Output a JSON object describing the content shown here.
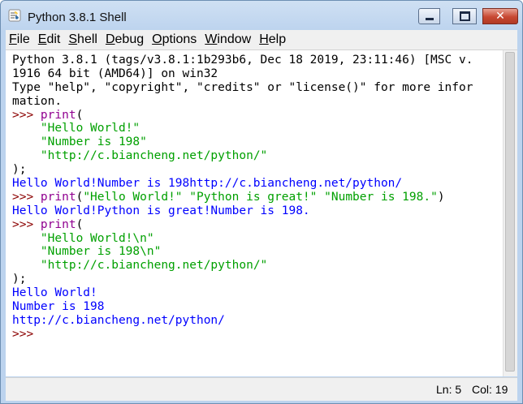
{
  "window": {
    "title": "Python 3.8.1 Shell"
  },
  "menu": [
    {
      "label": "File",
      "underline": "F",
      "rest": "ile"
    },
    {
      "label": "Edit",
      "underline": "E",
      "rest": "dit"
    },
    {
      "label": "Shell",
      "underline": "S",
      "rest": "hell"
    },
    {
      "label": "Debug",
      "underline": "D",
      "rest": "ebug"
    },
    {
      "label": "Options",
      "underline": "O",
      "rest": "ptions"
    },
    {
      "label": "Window",
      "underline": "W",
      "rest": "indow"
    },
    {
      "label": "Help",
      "underline": "H",
      "rest": "elp"
    }
  ],
  "editor": {
    "lines": [
      [
        {
          "c": "out",
          "t": "Python 3.8.1 (tags/v3.8.1:1b293b6, Dec 18 2019, 23:11:46) [MSC v."
        }
      ],
      [
        {
          "c": "out",
          "t": "1916 64 bit (AMD64)] on win32"
        }
      ],
      [
        {
          "c": "out",
          "t": "Type \"help\", \"copyright\", \"credits\" or \"license()\" for more infor"
        }
      ],
      [
        {
          "c": "out",
          "t": "mation."
        }
      ],
      [
        {
          "c": "prompt",
          "t": ">>> "
        },
        {
          "c": "builtin",
          "t": "print"
        },
        {
          "c": "black",
          "t": "("
        }
      ],
      [
        {
          "c": "black",
          "t": "    "
        },
        {
          "c": "str",
          "t": "\"Hello World!\""
        }
      ],
      [
        {
          "c": "black",
          "t": "    "
        },
        {
          "c": "str",
          "t": "\"Number is 198\""
        }
      ],
      [
        {
          "c": "black",
          "t": "    "
        },
        {
          "c": "str",
          "t": "\"http://c.biancheng.net/python/\""
        }
      ],
      [
        {
          "c": "black",
          "t": ");"
        }
      ],
      [
        {
          "c": "stdout",
          "t": "Hello World!Number is 198http://c.biancheng.net/python/"
        }
      ],
      [
        {
          "c": "prompt",
          "t": ">>> "
        },
        {
          "c": "builtin",
          "t": "print"
        },
        {
          "c": "black",
          "t": "("
        },
        {
          "c": "str",
          "t": "\"Hello World!\" \"Python is great!\" \"Number is 198.\""
        },
        {
          "c": "black",
          "t": ")"
        }
      ],
      [
        {
          "c": "stdout",
          "t": "Hello World!Python is great!Number is 198."
        }
      ],
      [
        {
          "c": "prompt",
          "t": ">>> "
        },
        {
          "c": "builtin",
          "t": "print"
        },
        {
          "c": "black",
          "t": "("
        }
      ],
      [
        {
          "c": "black",
          "t": "    "
        },
        {
          "c": "str",
          "t": "\"Hello World!\\n\""
        }
      ],
      [
        {
          "c": "black",
          "t": "    "
        },
        {
          "c": "str",
          "t": "\"Number is 198\\n\""
        }
      ],
      [
        {
          "c": "black",
          "t": "    "
        },
        {
          "c": "str",
          "t": "\"http://c.biancheng.net/python/\""
        }
      ],
      [
        {
          "c": "black",
          "t": ");"
        }
      ],
      [
        {
          "c": "stdout",
          "t": "Hello World!"
        }
      ],
      [
        {
          "c": "stdout",
          "t": "Number is 198"
        }
      ],
      [
        {
          "c": "stdout",
          "t": "http://c.biancheng.net/python/"
        }
      ],
      [
        {
          "c": "prompt",
          "t": ">>> "
        }
      ]
    ]
  },
  "status": {
    "ln": "Ln: 5",
    "col": "Col: 19"
  },
  "colors": {
    "prompt": "#8b0000",
    "builtin": "#900090",
    "string": "#00a000",
    "stdout": "#0000ff"
  },
  "icons": {
    "app": "python-idle-icon",
    "minimize": "minimize-icon",
    "maximize": "maximize-icon",
    "close": "close-icon"
  }
}
